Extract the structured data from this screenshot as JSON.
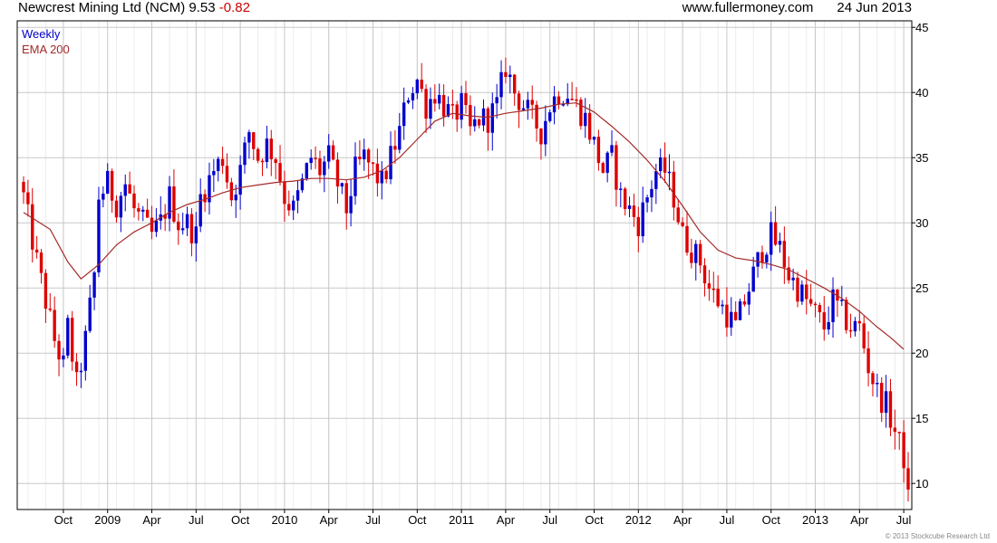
{
  "header": {
    "title": "Newcrest Mining Ltd (NCM)",
    "price": "9.53",
    "change": "-0.82",
    "website": "www.fullermoney.com",
    "date": "24 Jun 2013"
  },
  "footer": {
    "copyright": "© 2013 Stockcube Research Ltd"
  },
  "colors": {
    "up": "#0000cc",
    "down": "#dd0000",
    "ema": "#a52a2a",
    "grid": "#c8c8c8",
    "minor_grid": "#ececec"
  },
  "chart_data": {
    "type": "candlestick",
    "interval": "Weekly",
    "legend": [
      {
        "label": "Weekly",
        "color": "#0000cc"
      },
      {
        "label": "EMA 200",
        "color": "#a52a2a"
      }
    ],
    "y_axis": {
      "position": "right",
      "ylim": [
        8,
        45.5
      ],
      "ticks": [
        "10",
        "15",
        "20",
        "25",
        "30",
        "35",
        "40",
        "45"
      ]
    },
    "x_ticks": [
      {
        "label": "Oct",
        "week": 9
      },
      {
        "label": "2009",
        "week": 19
      },
      {
        "label": "Apr",
        "week": 29
      },
      {
        "label": "Jul",
        "week": 39
      },
      {
        "label": "Oct",
        "week": 49
      },
      {
        "label": "2010",
        "week": 59
      },
      {
        "label": "Apr",
        "week": 69
      },
      {
        "label": "Jul",
        "week": 79
      },
      {
        "label": "Oct",
        "week": 89
      },
      {
        "label": "2011",
        "week": 99
      },
      {
        "label": "Apr",
        "week": 109
      },
      {
        "label": "Jul",
        "week": 119
      },
      {
        "label": "Oct",
        "week": 129
      },
      {
        "label": "2012",
        "week": 139
      },
      {
        "label": "Apr",
        "week": 149
      },
      {
        "label": "Jul",
        "week": 159
      },
      {
        "label": "Oct",
        "week": 169
      },
      {
        "label": "2013",
        "week": 179
      },
      {
        "label": "Apr",
        "week": 189
      },
      {
        "label": "Jul",
        "week": 199
      }
    ],
    "close_path": [
      [
        0,
        32
      ],
      [
        3,
        27
      ],
      [
        5,
        24
      ],
      [
        7,
        21
      ],
      [
        9,
        19
      ],
      [
        10,
        22
      ],
      [
        12,
        17.5
      ],
      [
        14,
        21
      ],
      [
        16,
        26
      ],
      [
        17,
        32
      ],
      [
        19,
        33
      ],
      [
        21,
        31.5
      ],
      [
        23,
        33
      ],
      [
        25,
        31
      ],
      [
        27,
        30
      ],
      [
        29,
        29
      ],
      [
        31,
        30
      ],
      [
        33,
        32
      ],
      [
        35,
        30
      ],
      [
        37,
        30
      ],
      [
        39,
        29
      ],
      [
        40,
        32
      ],
      [
        43,
        34
      ],
      [
        45,
        35
      ],
      [
        47,
        32
      ],
      [
        49,
        34
      ],
      [
        51,
        37
      ],
      [
        53,
        35
      ],
      [
        55,
        36
      ],
      [
        57,
        35
      ],
      [
        59,
        32
      ],
      [
        61,
        31
      ],
      [
        63,
        33
      ],
      [
        65,
        35
      ],
      [
        67,
        34
      ],
      [
        69,
        35
      ],
      [
        71,
        33
      ],
      [
        73,
        31
      ],
      [
        75,
        34
      ],
      [
        77,
        35
      ],
      [
        79,
        34
      ],
      [
        81,
        33
      ],
      [
        83,
        35
      ],
      [
        85,
        37
      ],
      [
        87,
        40
      ],
      [
        89,
        41
      ],
      [
        91,
        39
      ],
      [
        93,
        40
      ],
      [
        95,
        39
      ],
      [
        97,
        38
      ],
      [
        99,
        39
      ],
      [
        101,
        37
      ],
      [
        103,
        38
      ],
      [
        105,
        38
      ],
      [
        107,
        39
      ],
      [
        109,
        42
      ],
      [
        111,
        40
      ],
      [
        113,
        39
      ],
      [
        115,
        38
      ],
      [
        117,
        37
      ],
      [
        119,
        39
      ],
      [
        121,
        40
      ],
      [
        123,
        40
      ],
      [
        125,
        39
      ],
      [
        127,
        38
      ],
      [
        129,
        36
      ],
      [
        131,
        34
      ],
      [
        133,
        35
      ],
      [
        135,
        32
      ],
      [
        137,
        31
      ],
      [
        139,
        30
      ],
      [
        141,
        32
      ],
      [
        143,
        34
      ],
      [
        145,
        34
      ],
      [
        147,
        32
      ],
      [
        149,
        29
      ],
      [
        151,
        28
      ],
      [
        153,
        27
      ],
      [
        155,
        25
      ],
      [
        157,
        24
      ],
      [
        159,
        23
      ],
      [
        161,
        22
      ],
      [
        163,
        24
      ],
      [
        165,
        26
      ],
      [
        167,
        28
      ],
      [
        169,
        29
      ],
      [
        171,
        28
      ],
      [
        173,
        26
      ],
      [
        175,
        25
      ],
      [
        177,
        24
      ],
      [
        179,
        23
      ],
      [
        181,
        22
      ],
      [
        183,
        24
      ],
      [
        185,
        23
      ],
      [
        187,
        22
      ],
      [
        189,
        22
      ],
      [
        191,
        19
      ],
      [
        193,
        17
      ],
      [
        195,
        16
      ],
      [
        197,
        14
      ],
      [
        199,
        12
      ],
      [
        200,
        9.53
      ]
    ],
    "ema_path": [
      [
        0,
        30.8
      ],
      [
        6,
        29.5
      ],
      [
        10,
        27
      ],
      [
        13,
        25.7
      ],
      [
        17,
        26.8
      ],
      [
        21,
        28.3
      ],
      [
        25,
        29.3
      ],
      [
        29,
        30
      ],
      [
        33,
        30.8
      ],
      [
        37,
        31.4
      ],
      [
        41,
        31.8
      ],
      [
        45,
        32.3
      ],
      [
        49,
        32.7
      ],
      [
        53,
        32.9
      ],
      [
        57,
        33.1
      ],
      [
        61,
        33.2
      ],
      [
        65,
        33.4
      ],
      [
        69,
        33.4
      ],
      [
        73,
        33.3
      ],
      [
        77,
        33.5
      ],
      [
        81,
        34
      ],
      [
        85,
        35
      ],
      [
        89,
        36.4
      ],
      [
        93,
        37.8
      ],
      [
        97,
        38.4
      ],
      [
        101,
        38.2
      ],
      [
        105,
        38.1
      ],
      [
        109,
        38.4
      ],
      [
        113,
        38.6
      ],
      [
        117,
        38.8
      ],
      [
        121,
        39.1
      ],
      [
        125,
        39.2
      ],
      [
        129,
        38.5
      ],
      [
        133,
        37.4
      ],
      [
        137,
        36.2
      ],
      [
        141,
        34.8
      ],
      [
        145,
        33.2
      ],
      [
        149,
        31.3
      ],
      [
        153,
        29.3
      ],
      [
        157,
        27.9
      ],
      [
        161,
        27.3
      ],
      [
        165,
        27.1
      ],
      [
        169,
        26.8
      ],
      [
        173,
        26.4
      ],
      [
        177,
        25.7
      ],
      [
        181,
        25
      ],
      [
        185,
        24.2
      ],
      [
        189,
        23.2
      ],
      [
        193,
        22
      ],
      [
        196,
        21.2
      ],
      [
        199,
        20.3
      ]
    ]
  }
}
